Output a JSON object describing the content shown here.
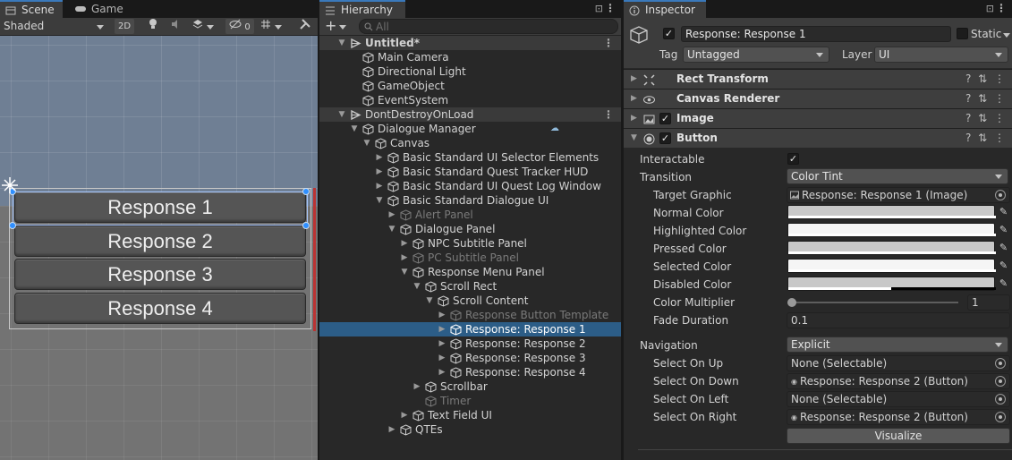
{
  "scene_panel": {
    "tabs": [
      {
        "label": "Scene",
        "icon": "scene-icon"
      },
      {
        "label": "Game",
        "icon": "gamepad-icon"
      }
    ],
    "shading_mode": "Shaded",
    "mode_2d": "2D",
    "hidden_count": "0",
    "responses": [
      "Response 1",
      "Response 2",
      "Response 3",
      "Response 4"
    ]
  },
  "hierarchy": {
    "tab_label": "Hierarchy",
    "search_placeholder": "All",
    "add_label": "+",
    "rows": [
      {
        "label": "Untitled*",
        "depth": 0,
        "type": "scene",
        "expanded": true
      },
      {
        "label": "Main Camera",
        "depth": 1,
        "type": "object"
      },
      {
        "label": "Directional Light",
        "depth": 1,
        "type": "object"
      },
      {
        "label": "GameObject",
        "depth": 1,
        "type": "object"
      },
      {
        "label": "EventSystem",
        "depth": 1,
        "type": "object"
      },
      {
        "label": "DontDestroyOnLoad",
        "depth": 0,
        "type": "scene",
        "expanded": true
      },
      {
        "label": "Dialogue Manager",
        "depth": 1,
        "type": "object",
        "expanded": true
      },
      {
        "label": "Canvas",
        "depth": 2,
        "type": "object",
        "expanded": true
      },
      {
        "label": "Basic Standard UI Selector Elements",
        "depth": 3,
        "type": "object",
        "collapsed": true
      },
      {
        "label": "Basic Standard Quest Tracker HUD",
        "depth": 3,
        "type": "object",
        "collapsed": true
      },
      {
        "label": "Basic Standard UI Quest Log Window",
        "depth": 3,
        "type": "object",
        "collapsed": true
      },
      {
        "label": "Basic Standard Dialogue UI",
        "depth": 3,
        "type": "object",
        "expanded": true
      },
      {
        "label": "Alert Panel",
        "depth": 4,
        "type": "object",
        "collapsed": true,
        "dim": true
      },
      {
        "label": "Dialogue Panel",
        "depth": 4,
        "type": "object",
        "expanded": true
      },
      {
        "label": "NPC Subtitle Panel",
        "depth": 5,
        "type": "object",
        "collapsed": true
      },
      {
        "label": "PC Subtitle Panel",
        "depth": 5,
        "type": "object",
        "collapsed": true,
        "dim": true
      },
      {
        "label": "Response Menu Panel",
        "depth": 5,
        "type": "object",
        "expanded": true
      },
      {
        "label": "Scroll Rect",
        "depth": 6,
        "type": "object",
        "expanded": true
      },
      {
        "label": "Scroll Content",
        "depth": 7,
        "type": "object",
        "expanded": true
      },
      {
        "label": "Response Button Template",
        "depth": 8,
        "type": "object",
        "collapsed": true,
        "dim": true
      },
      {
        "label": "Response: Response 1",
        "depth": 8,
        "type": "object",
        "collapsed": true,
        "selected": true
      },
      {
        "label": "Response: Response 2",
        "depth": 8,
        "type": "object",
        "collapsed": true
      },
      {
        "label": "Response: Response 3",
        "depth": 8,
        "type": "object",
        "collapsed": true
      },
      {
        "label": "Response: Response 4",
        "depth": 8,
        "type": "object",
        "collapsed": true
      },
      {
        "label": "Scrollbar",
        "depth": 6,
        "type": "object",
        "collapsed": true
      },
      {
        "label": "Timer",
        "depth": 6,
        "type": "object",
        "dim": true
      },
      {
        "label": "Text Field UI",
        "depth": 5,
        "type": "object",
        "collapsed": true
      },
      {
        "label": "QTEs",
        "depth": 4,
        "type": "object",
        "collapsed": true
      }
    ]
  },
  "inspector": {
    "tab_label": "Inspector",
    "object_name": "Response: Response 1",
    "static_label": "Static",
    "tag_label": "Tag",
    "tag_value": "Untagged",
    "layer_label": "Layer",
    "layer_value": "UI",
    "components": [
      {
        "name": "Rect Transform",
        "icon": "rect-transform-icon",
        "has_checkbox": false
      },
      {
        "name": "Canvas Renderer",
        "icon": "eye-icon",
        "has_checkbox": false
      },
      {
        "name": "Image",
        "icon": "image-icon",
        "has_checkbox": true
      },
      {
        "name": "Button",
        "icon": "button-icon",
        "has_checkbox": true
      }
    ],
    "button": {
      "interactable_label": "Interactable",
      "transition_label": "Transition",
      "transition_value": "Color Tint",
      "target_graphic_label": "Target Graphic",
      "target_graphic_value": "Response: Response 1 (Image)",
      "normal_color_label": "Normal Color",
      "highlighted_color_label": "Highlighted Color",
      "pressed_color_label": "Pressed Color",
      "selected_color_label": "Selected Color",
      "disabled_color_label": "Disabled Color",
      "color_multiplier_label": "Color Multiplier",
      "color_multiplier_value": "1",
      "fade_duration_label": "Fade Duration",
      "fade_duration_value": "0.1",
      "navigation_label": "Navigation",
      "navigation_value": "Explicit",
      "select_on_up_label": "Select On Up",
      "select_on_up_value": "None (Selectable)",
      "select_on_down_label": "Select On Down",
      "select_on_down_value": "Response: Response 2 (Button)",
      "select_on_left_label": "Select On Left",
      "select_on_left_value": "None (Selectable)",
      "select_on_right_label": "Select On Right",
      "select_on_right_value": "Response: Response 2 (Button)",
      "visualize_label": "Visualize"
    },
    "colors": {
      "normal": "#c8c8c8",
      "highlighted": "#f5f5f5",
      "pressed": "#c8c8c8",
      "selected": "#f5f5f5",
      "disabled": "#c8c8c8"
    }
  },
  "theme": {
    "accent": "#3a79bb",
    "selection": "#2c5d87",
    "panel_bg": "#282828",
    "header_bg": "#3e3e3e"
  }
}
